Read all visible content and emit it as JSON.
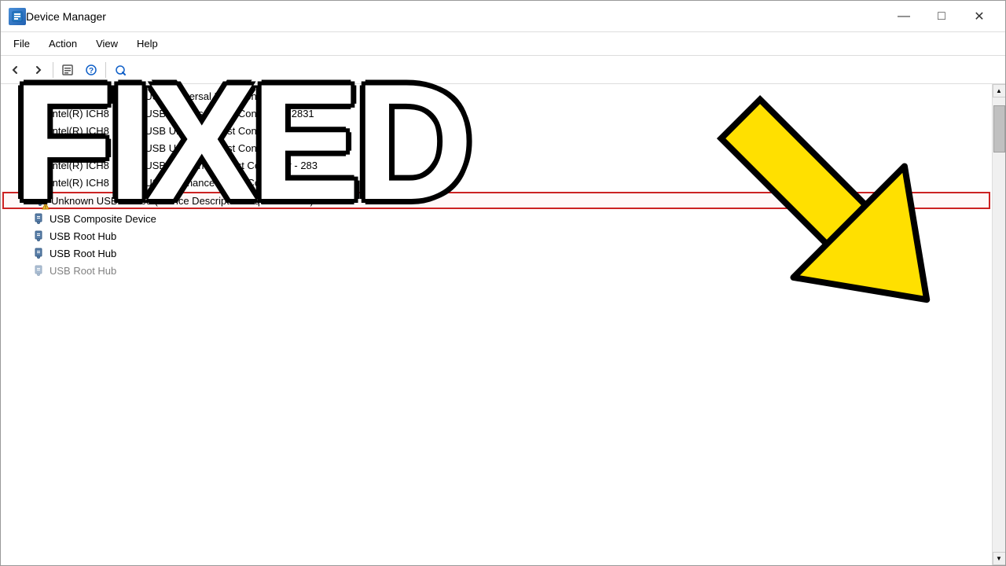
{
  "window": {
    "title": "Device Manager",
    "icon": "device-manager-icon"
  },
  "title_controls": {
    "minimize": "—",
    "maximize": "□",
    "close": "✕"
  },
  "menu": {
    "items": [
      "File",
      "Action",
      "View",
      "Help"
    ]
  },
  "overlay": {
    "fixed_text": "FIXED"
  },
  "device_list": {
    "items": [
      {
        "id": "ich8-2830",
        "label": "Intel(R) ICH8 Family USB Universal Host Controller - 2830",
        "icon": "usb",
        "warning": false
      },
      {
        "id": "ich8-2831",
        "label": "Intel(R) ICH8 Family USB Universal Host Controller - 2831",
        "icon": "usb",
        "warning": false
      },
      {
        "id": "ich8-2832",
        "label": "Intel(R) ICH8 Family USB Universal Host Controller - 2832",
        "icon": "usb",
        "warning": false
      },
      {
        "id": "ich8-2834",
        "label": "Intel(R) ICH8 Family USB Universal Host Controller - 2834",
        "icon": "usb",
        "warning": false
      },
      {
        "id": "ich8-283",
        "label": "Intel(R) ICH8 Family USB2 Enhanced Host Controller - 283",
        "icon": "usb",
        "warning": false
      },
      {
        "id": "ich8-283a",
        "label": "Intel(R) ICH8 Family USB2 Enhanced Host Controller - 283A",
        "icon": "usb",
        "warning": false
      },
      {
        "id": "unknown-usb",
        "label": "Unknown USB Device (Device Descriptor Request Failed)",
        "icon": "usb-warning",
        "warning": true,
        "highlighted": true
      },
      {
        "id": "usb-composite",
        "label": "USB Composite Device",
        "icon": "usb",
        "warning": false
      },
      {
        "id": "usb-root-hub-1",
        "label": "USB Root Hub",
        "icon": "usb",
        "warning": false
      },
      {
        "id": "usb-root-hub-2",
        "label": "USB Root Hub",
        "icon": "usb",
        "warning": false
      },
      {
        "id": "usb-root-hub-3",
        "label": "USB Root Hub",
        "icon": "usb",
        "warning": false
      }
    ]
  }
}
